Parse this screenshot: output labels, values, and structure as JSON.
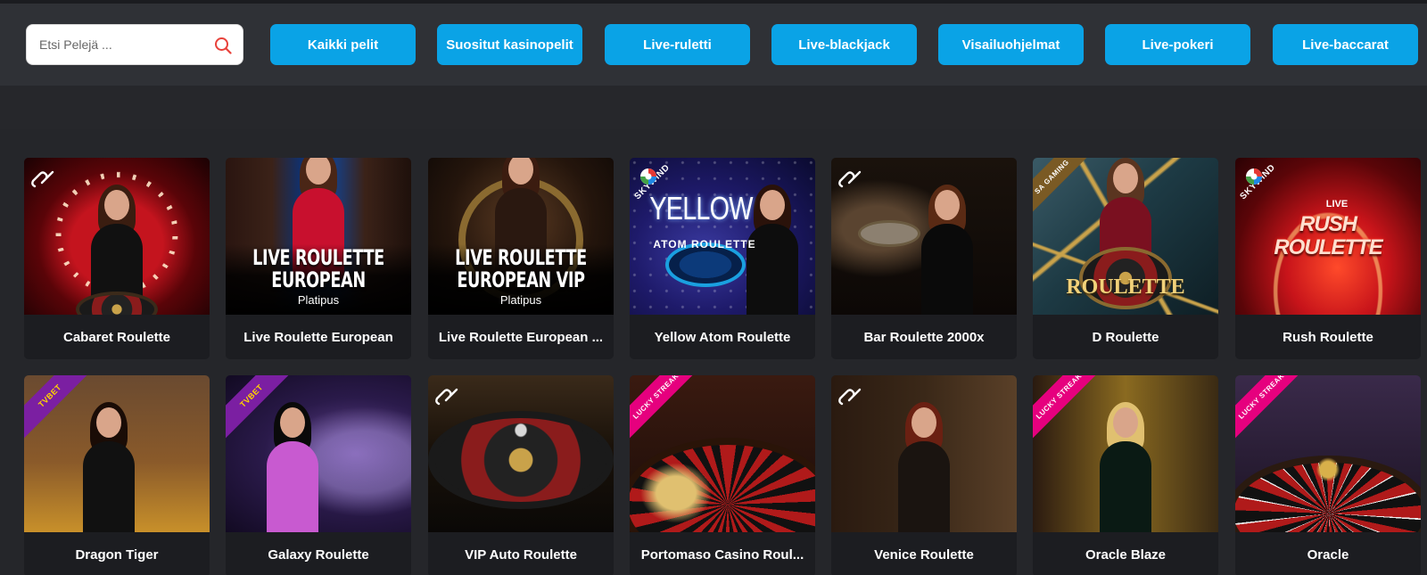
{
  "search": {
    "placeholder": "Etsi Pelejä ...",
    "icon": "search-icon"
  },
  "filters": [
    {
      "label": "Kaikki pelit"
    },
    {
      "label": "Suositut kasinopelit"
    },
    {
      "label": "Live-ruletti"
    },
    {
      "label": "Live-blackjack"
    },
    {
      "label": "Visailuohjelmat"
    },
    {
      "label": "Live-pokeri"
    },
    {
      "label": "Live-baccarat"
    }
  ],
  "colors": {
    "accent": "#0aa3e6",
    "page_bg": "#25262a",
    "card_bg": "#1c1d21",
    "search_icon": "#e8413a"
  },
  "games_row1": [
    {
      "title": "Cabaret Roulette",
      "provider_icon": "evolution-infinity-icon"
    },
    {
      "title": "Live Roulette European",
      "provider_icon": "",
      "art_title": "LIVE ROULETTE EUROPEAN",
      "art_sub": "Platipus"
    },
    {
      "title": "Live Roulette European ...",
      "provider_icon": "",
      "art_title": "LIVE ROULETTE EUROPEAN VIP",
      "art_sub": "Platipus"
    },
    {
      "title": "Yellow Atom Roulette",
      "provider_icon": "skywind-icon",
      "art_title": "YELLOW",
      "art_sub": "ATOM ROULETTE",
      "badge": "SKYWIND"
    },
    {
      "title": "Bar Roulette 2000x",
      "provider_icon": "evolution-infinity-icon"
    },
    {
      "title": "D Roulette",
      "provider_icon": "sa-gaming-icon",
      "art_title": "ROULETTE",
      "badge": "SA GAMING"
    },
    {
      "title": "Rush Roulette",
      "provider_icon": "skywind-icon",
      "art_title": "RUSH ROULETTE",
      "art_sub": "LIVE",
      "badge": "SKYWIND"
    }
  ],
  "games_row2": [
    {
      "title": "Dragon Tiger",
      "provider_icon": "tvbet-icon",
      "badge": "TVBET"
    },
    {
      "title": "Galaxy Roulette",
      "provider_icon": "tvbet-icon",
      "badge": "TVBET"
    },
    {
      "title": "VIP Auto Roulette",
      "provider_icon": "evolution-infinity-icon"
    },
    {
      "title": "Portomaso Casino Roul...",
      "provider_icon": "lucky-streak-icon",
      "badge": "LUCKY STREAK"
    },
    {
      "title": "Venice Roulette",
      "provider_icon": "evolution-infinity-icon"
    },
    {
      "title": "Oracle Blaze",
      "provider_icon": "lucky-streak-icon",
      "badge": "LUCKY STREAK"
    },
    {
      "title": "Oracle",
      "provider_icon": "lucky-streak-icon",
      "badge": "LUCKY STREAK"
    }
  ]
}
